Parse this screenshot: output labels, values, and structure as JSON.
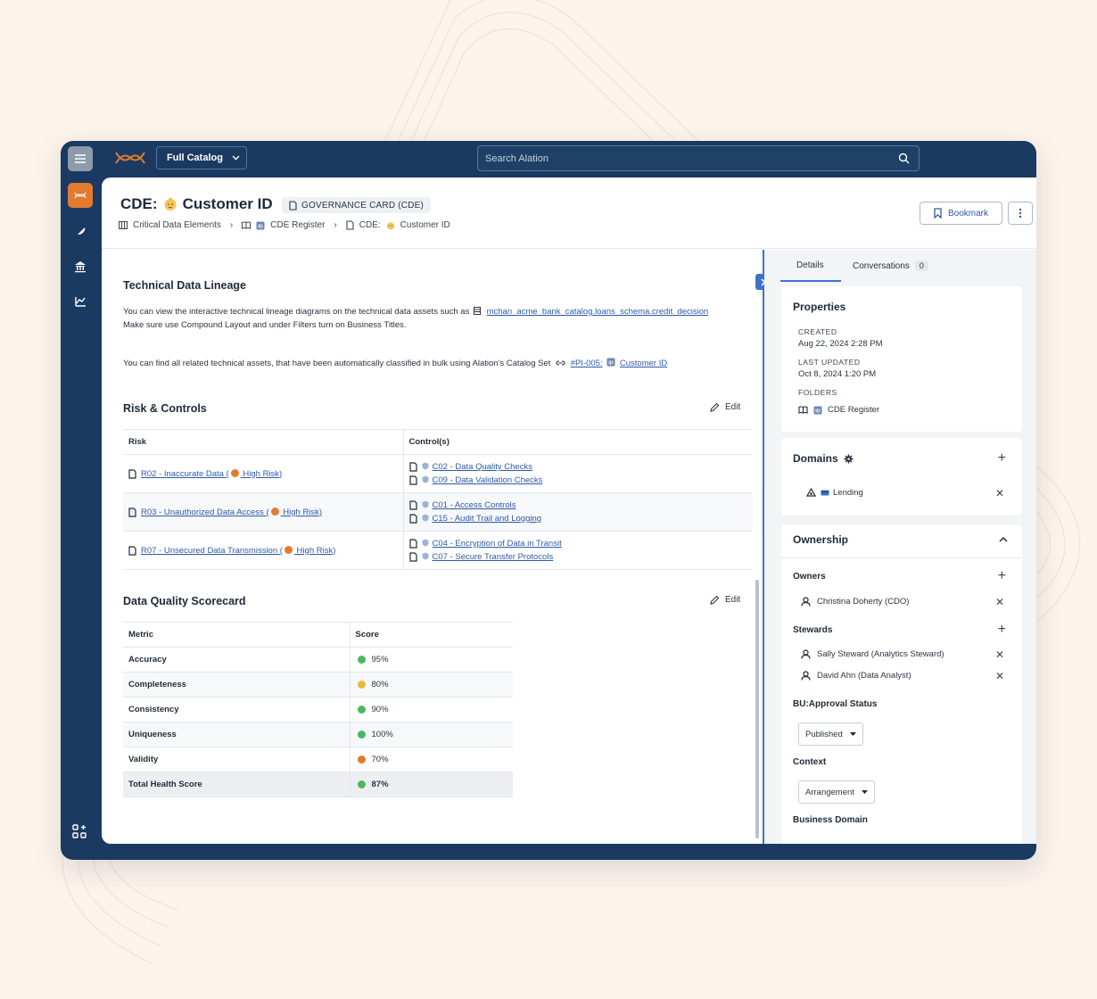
{
  "topbar": {
    "catalog_label": "Full Catalog",
    "search_placeholder": "Search Alation"
  },
  "header": {
    "title_prefix": "CDE:",
    "title": "Customer ID",
    "badge": "GOVERNANCE CARD (CDE)",
    "breadcrumbs": [
      "Critical Data Elements",
      "CDE Register",
      "CDE:",
      "Customer ID"
    ],
    "bookmark_label": "Bookmark"
  },
  "lineage": {
    "title": "Technical Data Lineage",
    "para1_text": "You can view the interactive technical lineage diagrams on the technical data assets such as",
    "para1_link": "mchan_acme_bank_catalog.loans_schema.credit_decision",
    "para1_line2": "Make sure use Compound Layout and under Filters turn on Business Titles.",
    "para2_text": "You can find all related technical assets, that have been automatically classified in bulk using Alation's Catalog Set",
    "para2_link1": "#PI-005:",
    "para2_link2": "Customer ID"
  },
  "risk": {
    "title": "Risk & Controls",
    "edit_label": "Edit",
    "headers": [
      "Risk",
      "Control(s)"
    ],
    "rows": [
      {
        "risk_prefix": "R02 - Inaccurate Data (",
        "risk_suffix": " High Risk)",
        "controls": [
          "C02 - Data Quality Checks",
          "C09 - Data Validation Checks"
        ]
      },
      {
        "risk_prefix": "R03 - Unauthorized Data Access (",
        "risk_suffix": " High Risk)",
        "controls": [
          "C01 - Access Controls",
          "C15 - Audit Trail and Logging"
        ]
      },
      {
        "risk_prefix": "R07 - Unsecured Data Transmission (",
        "risk_suffix": " High Risk)",
        "controls": [
          "C04 - Encryption of Data in Transit",
          "C07 - Secure Transfer Protocols"
        ]
      }
    ],
    "risk_color": "#e27b2f"
  },
  "dq": {
    "title": "Data Quality Scorecard",
    "edit_label": "Edit",
    "headers": [
      "Metric",
      "Score"
    ],
    "rows": [
      {
        "metric": "Accuracy",
        "score": "95%",
        "color": "#4cb862"
      },
      {
        "metric": "Completeness",
        "score": "80%",
        "color": "#e8b93a"
      },
      {
        "metric": "Consistency",
        "score": "90%",
        "color": "#4cb862"
      },
      {
        "metric": "Uniqueness",
        "score": "100%",
        "color": "#4cb862"
      },
      {
        "metric": "Validity",
        "score": "70%",
        "color": "#e27b2f"
      },
      {
        "metric": "Total Health Score",
        "score": "87%",
        "color": "#4cb862"
      }
    ]
  },
  "right": {
    "tabs": {
      "details": "Details",
      "conversations": "Conversations",
      "conversations_count": "0"
    },
    "properties": {
      "title": "Properties",
      "created_label": "CREATED",
      "created_value": "Aug 22, 2024 2:28 PM",
      "updated_label": "LAST UPDATED",
      "updated_value": "Oct 8, 2024 1:20 PM",
      "folders_label": "FOLDERS",
      "folder_value": "CDE Register"
    },
    "domains": {
      "title": "Domains",
      "item": "Lending"
    },
    "ownership": {
      "title": "Ownership",
      "owners_label": "Owners",
      "owners": [
        "Christina Doherty (CDO)"
      ],
      "stewards_label": "Stewards",
      "stewards": [
        "Sally Steward (Analytics Steward)",
        "David Ahn (Data Analyst)"
      ],
      "approval_label": "BU:Approval Status",
      "approval_value": "Published",
      "context_label": "Context",
      "context_value": "Arrangement",
      "business_domain_label": "Business Domain"
    }
  },
  "colors": {
    "navy": "#1b3a61",
    "accent_orange": "#e27b2f",
    "link_blue": "#2d5aa8"
  }
}
